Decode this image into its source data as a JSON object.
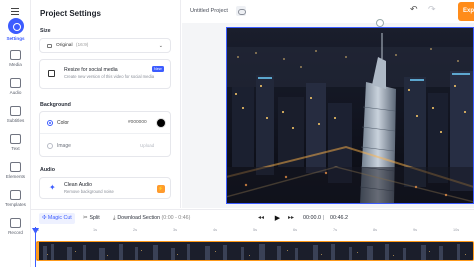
{
  "sidebar": {
    "items": [
      {
        "label": "Settings",
        "icon": "settings-icon",
        "active": true
      },
      {
        "label": "Media",
        "icon": "media-icon"
      },
      {
        "label": "Audio",
        "icon": "audio-icon"
      },
      {
        "label": "Subtitles",
        "icon": "subtitles-icon"
      },
      {
        "label": "Text",
        "icon": "text-icon"
      },
      {
        "label": "Elements",
        "icon": "elements-icon"
      },
      {
        "label": "Templates",
        "icon": "templates-icon"
      },
      {
        "label": "Record",
        "icon": "record-icon"
      }
    ]
  },
  "panel": {
    "title": "Project Settings",
    "size": {
      "label": "Size",
      "value": "Original",
      "ratio": "(16:9)"
    },
    "resize": {
      "title": "Resize for social media",
      "description": "Create new version of this video for social media",
      "badge": "New"
    },
    "background": {
      "label": "Background",
      "color_label": "Color",
      "color_value": "#000000",
      "image_label": "Image",
      "upload_label": "Upload"
    },
    "audio": {
      "label": "Audio",
      "clean_title": "Clean Audio",
      "clean_description": "Remove background noise",
      "badge_icon": "bolt-icon"
    }
  },
  "topbar": {
    "project_name": "Untitled Project",
    "export_label": "Exp"
  },
  "toolbar": {
    "magic_cut": "Magic Cut",
    "split": "Split",
    "download": "Download Section",
    "download_range": "(0:00 - 0:46)",
    "current_time": "00:00.0",
    "separator": "|",
    "total_time": "00:46.2"
  },
  "timeline": {
    "ticks": [
      "0s",
      "1s",
      "2s",
      "3s",
      "4s",
      "5s",
      "6s",
      "7s",
      "8s",
      "9s",
      "10s"
    ]
  },
  "colors": {
    "accent": "#3c5cff",
    "export": "#ff8c1a",
    "track_border": "#ff9a1a"
  }
}
